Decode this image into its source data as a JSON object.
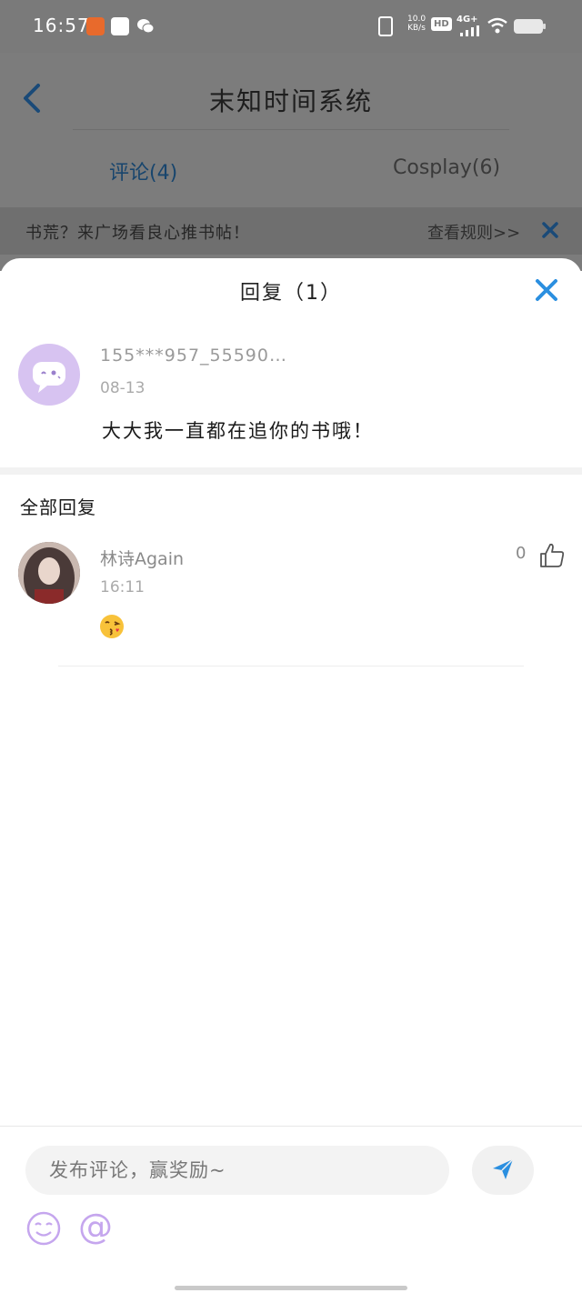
{
  "status_bar": {
    "time": "16:57",
    "net_speed_top": "10.0",
    "net_speed_bottom": "KB/s",
    "hd": "HD",
    "network": "4G+"
  },
  "header": {
    "title": "末知时间系统",
    "tabs": [
      {
        "label": "评论(4)",
        "active": true
      },
      {
        "label": "Cosplay(6)",
        "active": false
      }
    ]
  },
  "notice": {
    "text": "书荒？来广场看良心推书帖！",
    "rules_link": "查看规则>>"
  },
  "sheet": {
    "title": "回复（1）",
    "original_comment": {
      "user": "155***957_55590…",
      "date": "08-13",
      "text": "大大我一直都在追你的书哦！"
    },
    "all_replies_label": "全部回复",
    "replies": [
      {
        "user": "林诗Again",
        "time": "16:11",
        "emoji": "kissing-face",
        "likes": "0"
      }
    ]
  },
  "comment_bar": {
    "placeholder": "发布评论，赢奖励~"
  },
  "colors": {
    "accent": "#2b8fe0",
    "overlay": "#7a7a7a",
    "avatar_purple": "#d7c3f1",
    "icon_purple": "#c5a6ee"
  }
}
